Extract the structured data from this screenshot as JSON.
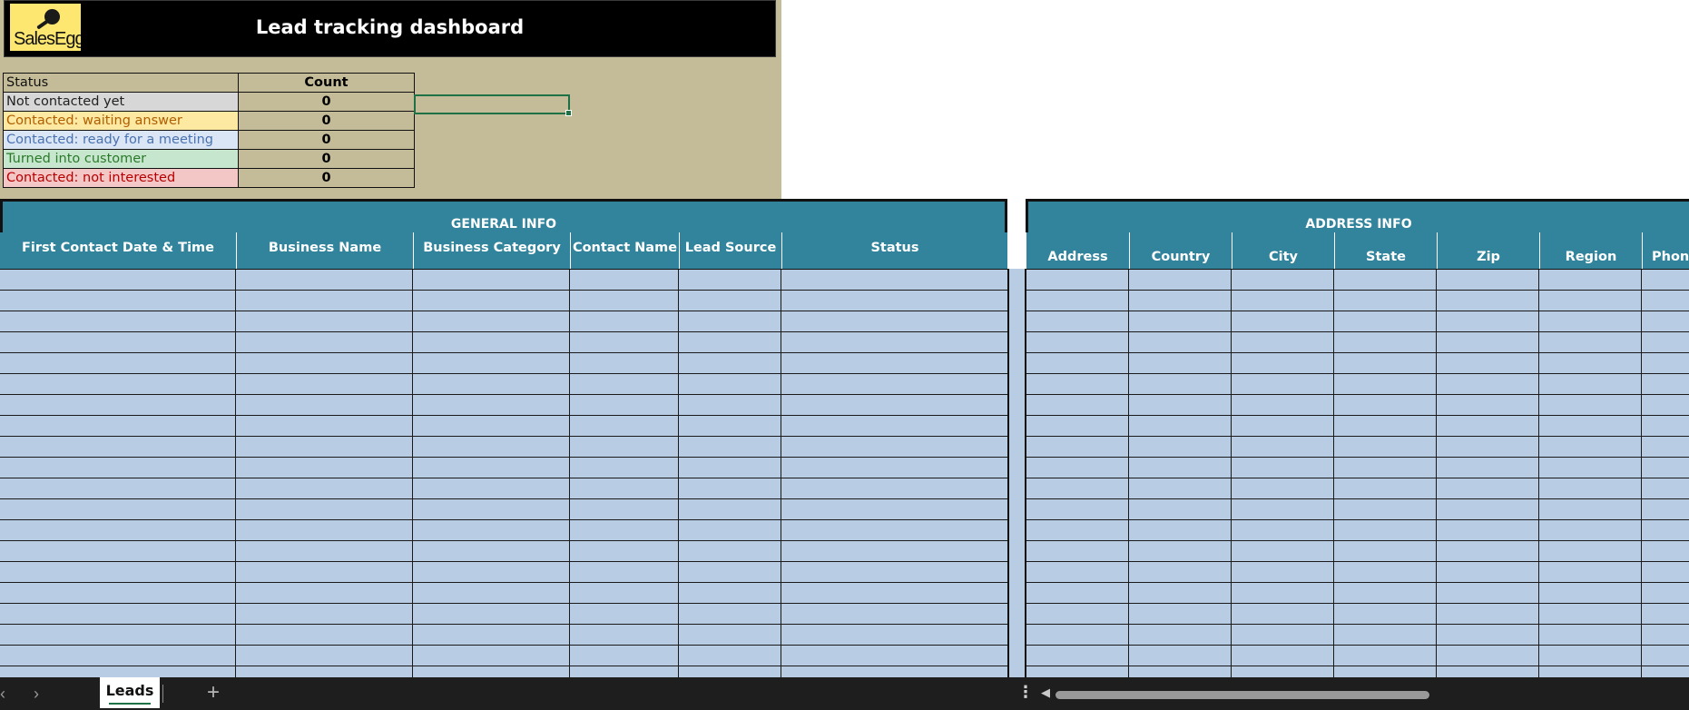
{
  "app": {
    "dashboard_title": "Lead tracking dashboard",
    "logo_text": "SalesEgg"
  },
  "status_summary": {
    "headers": {
      "status": "Status",
      "count": "Count"
    },
    "rows": [
      {
        "label": "Not contacted yet",
        "count": "0",
        "color": "#d7d7d7"
      },
      {
        "label": "Contacted: waiting answer",
        "count": "0",
        "color": "#fde9a1"
      },
      {
        "label": "Contacted: ready for a meeting",
        "count": "0",
        "color": "#dae6f5"
      },
      {
        "label": "Turned into customer",
        "count": "0",
        "color": "#c7e6ce"
      },
      {
        "label": "Contacted: not interested",
        "count": "0",
        "color": "#f4c7c7"
      }
    ]
  },
  "sections": {
    "general": "GENERAL INFO",
    "address": "ADDRESS INFO"
  },
  "general_columns": [
    "First Contact Date & Time",
    "Business Name",
    "Business Category",
    "Contact Name",
    "Lead Source",
    "Status"
  ],
  "address_columns": [
    "Address",
    "Country",
    "City",
    "State",
    "Zip",
    "Region",
    "Phone"
  ],
  "sheet_tabs": {
    "active": "Leads"
  },
  "icons": {
    "prev": "chevron-left-icon",
    "next": "chevron-right-icon",
    "add": "plus-icon",
    "more": "vertical-dots-icon",
    "scroll_left": "triangle-left-icon"
  },
  "colors": {
    "header_teal": "#31849b",
    "grid_blue": "#b8cce4",
    "dashboard_tan": "#c4bc98",
    "logo_yellow": "#fde770"
  }
}
